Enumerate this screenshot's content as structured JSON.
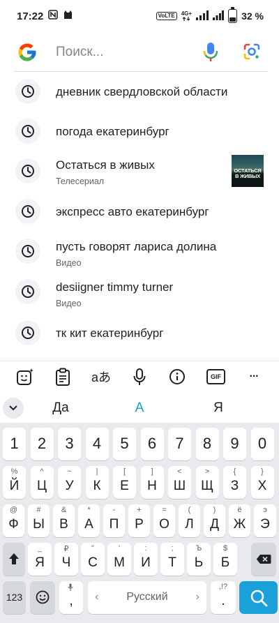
{
  "status_bar": {
    "time": "17:22",
    "volte": "VoLTE",
    "network": "4G+",
    "battery_percent": "32 %",
    "battery_level": 0.32
  },
  "search": {
    "placeholder": "Поиск..."
  },
  "suggestions": [
    {
      "text": "дневник свердловской области",
      "subtitle": ""
    },
    {
      "text": "погода екатеринбург",
      "subtitle": ""
    },
    {
      "text": "Остаться в живых",
      "subtitle": "Телесериал",
      "thumbnail_text": "ОСТАТЬСЯ В ЖИВЫХ"
    },
    {
      "text": "экспресс авто екатеринбург",
      "subtitle": ""
    },
    {
      "text": "пусть говорят лариса долина",
      "subtitle": "Видео"
    },
    {
      "text": "desiigner timmy turner",
      "subtitle": "Видео"
    },
    {
      "text": "тк кит екатеринбург",
      "subtitle": ""
    }
  ],
  "keyboard_toolbar": {
    "translate_label": "aあ",
    "gif_label": "GIF",
    "more_label": "···"
  },
  "word_suggestions": [
    "Да",
    "А",
    "Я"
  ],
  "keyboard": {
    "number_row": [
      "1",
      "2",
      "3",
      "4",
      "5",
      "6",
      "7",
      "8",
      "9",
      "0"
    ],
    "row1": [
      {
        "main": "Й",
        "hint": "%"
      },
      {
        "main": "Ц",
        "hint": "^"
      },
      {
        "main": "У",
        "hint": "~"
      },
      {
        "main": "К",
        "hint": "|"
      },
      {
        "main": "Е",
        "hint": "["
      },
      {
        "main": "Н",
        "hint": "]"
      },
      {
        "main": "Ш",
        "hint": "<"
      },
      {
        "main": "Щ",
        "hint": ">"
      },
      {
        "main": "З",
        "hint": "{"
      },
      {
        "main": "Х",
        "hint": "}"
      }
    ],
    "row2": [
      {
        "main": "Ф",
        "hint": "@"
      },
      {
        "main": "Ы",
        "hint": "#"
      },
      {
        "main": "В",
        "hint": "&"
      },
      {
        "main": "А",
        "hint": "*"
      },
      {
        "main": "П",
        "hint": "-"
      },
      {
        "main": "Р",
        "hint": "+"
      },
      {
        "main": "О",
        "hint": "="
      },
      {
        "main": "Л",
        "hint": "("
      },
      {
        "main": "Д",
        "hint": ")"
      },
      {
        "main": "Ж",
        "hint": "ё"
      },
      {
        "main": "Э",
        "hint": "э"
      }
    ],
    "row3": [
      {
        "main": "Я",
        "hint": "_"
      },
      {
        "main": "Ч",
        "hint": "₽"
      },
      {
        "main": "С",
        "hint": "\""
      },
      {
        "main": "М",
        "hint": "'"
      },
      {
        "main": "И",
        "hint": ":"
      },
      {
        "main": "Т",
        "hint": ";"
      },
      {
        "main": "Ь",
        "hint": "Ъ"
      },
      {
        "main": "Б",
        "hint": "$"
      },
      {
        "main": "Ю",
        "hint": "€"
      }
    ],
    "symbols_label": "123",
    "comma": ",",
    "space_label": "Русский",
    "period_hint": ",!?",
    "period": "."
  },
  "colors": {
    "accent": "#1ba1d9",
    "keyboard_bg": "#e8eaed"
  }
}
